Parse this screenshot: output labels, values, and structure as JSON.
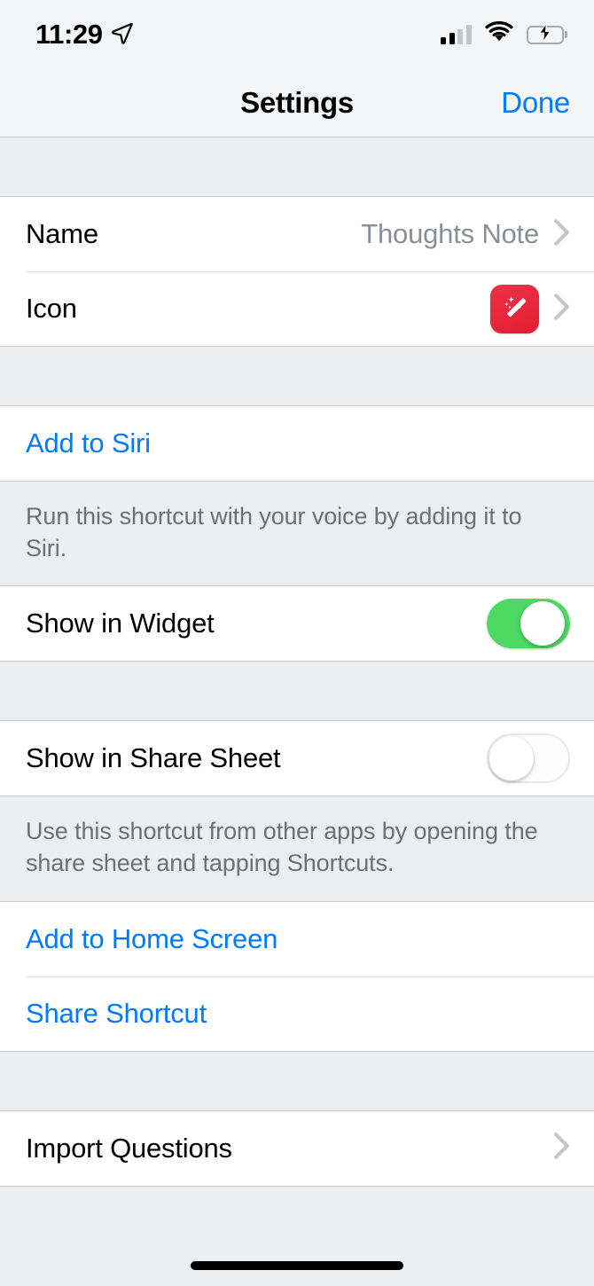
{
  "status_bar": {
    "time": "11:29",
    "location_icon": "location-arrow-icon",
    "signal_icon": "cellular-signal-icon",
    "signal_bars_filled": 2,
    "signal_bars_total": 4,
    "wifi_icon": "wifi-icon",
    "battery_icon": "battery-charging-icon",
    "battery_charging": true,
    "colors": {
      "battery_green": "#4ED964"
    }
  },
  "nav_bar": {
    "title": "Settings",
    "done_label": "Done",
    "accent": "#007AFF"
  },
  "sections": [
    {
      "rows": [
        {
          "label": "Name",
          "value": "Thoughts Note",
          "accessory": "chevron-right-icon"
        },
        {
          "label": "Icon",
          "value": "",
          "accessory": "chevron-right-icon",
          "icon": "magic-wand-app-icon",
          "icon_color": "#E8182F"
        }
      ]
    },
    {
      "rows": [
        {
          "label": "Add to Siri",
          "style": "link"
        }
      ],
      "footer": "Run this shortcut with your voice by adding it to Siri."
    },
    {
      "rows": [
        {
          "label": "Show in Widget",
          "toggle": true,
          "toggle_on": true
        }
      ]
    },
    {
      "rows": [
        {
          "label": "Show in Share Sheet",
          "toggle": true,
          "toggle_on": false
        }
      ],
      "footer": "Use this shortcut from other apps by opening the share sheet and tapping Shortcuts."
    },
    {
      "rows": [
        {
          "label": "Add to Home Screen",
          "style": "link"
        },
        {
          "label": "Share Shortcut",
          "style": "link"
        }
      ]
    },
    {
      "rows": [
        {
          "label": "Import Questions",
          "accessory": "chevron-right-icon"
        }
      ]
    }
  ],
  "home_indicator": "home-indicator"
}
